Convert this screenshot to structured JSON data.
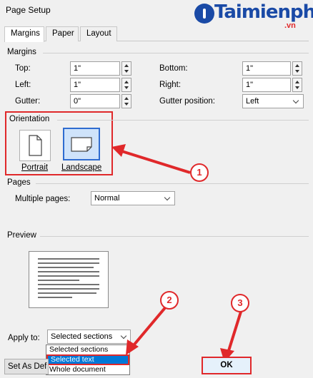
{
  "window": {
    "title": "Page Setup"
  },
  "watermark": {
    "brand": "Taimienphi",
    "suffix": ".vn"
  },
  "tabs": [
    {
      "label": "Margins",
      "active": true
    },
    {
      "label": "Paper",
      "active": false
    },
    {
      "label": "Layout",
      "active": false
    }
  ],
  "margins": {
    "heading": "Margins",
    "top": {
      "label": "Top:",
      "value": "1\""
    },
    "bottom": {
      "label": "Bottom:",
      "value": "1\""
    },
    "left": {
      "label": "Left:",
      "value": "1\""
    },
    "right": {
      "label": "Right:",
      "value": "1\""
    },
    "gutter": {
      "label": "Gutter:",
      "value": "0\""
    },
    "gutter_position": {
      "label": "Gutter position:",
      "value": "Left"
    }
  },
  "orientation": {
    "heading": "Orientation",
    "portrait": "Portrait",
    "landscape": "Landscape",
    "selected": "Landscape"
  },
  "pages": {
    "heading": "Pages",
    "multiple_pages_label": "Multiple pages:",
    "multiple_pages_value": "Normal"
  },
  "preview": {
    "heading": "Preview"
  },
  "apply_to": {
    "label": "Apply to:",
    "value": "Selected sections",
    "options": [
      "Selected sections",
      "Selected text",
      "Whole document"
    ],
    "highlighted": "Selected text"
  },
  "buttons": {
    "set_as_default": "Set As Def",
    "ok": "OK"
  },
  "callouts": [
    "1",
    "2",
    "3"
  ],
  "colors": {
    "accent_red": "#e0282a",
    "select_blue": "#0078d7",
    "brand_blue": "#1a4aa6"
  }
}
